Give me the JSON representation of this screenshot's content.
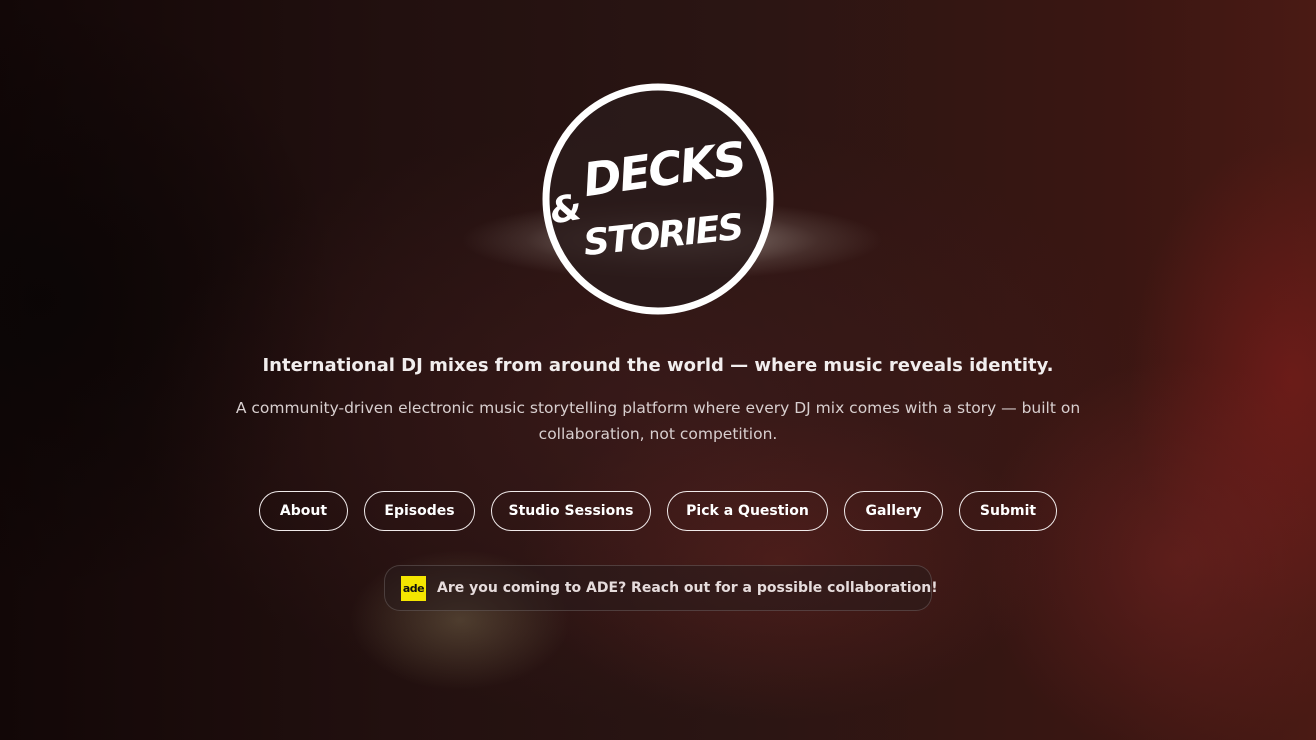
{
  "logo": {
    "line1": "DECKS",
    "ampersand": "&",
    "line2": "STORIES"
  },
  "hero": {
    "tagline": "International DJ mixes from around the world — where music reveals identity.",
    "description": "A community-driven electronic music storytelling platform where every DJ mix comes with a story — built on collaboration, not competition."
  },
  "nav": {
    "items": [
      {
        "label": "About"
      },
      {
        "label": "Episodes"
      },
      {
        "label": "Studio Sessions"
      },
      {
        "label": "Pick a Question"
      },
      {
        "label": "Gallery"
      },
      {
        "label": "Submit"
      }
    ]
  },
  "notice": {
    "logo_text": "ade",
    "text": "Are you coming to ADE? Reach out for a possible collaboration!"
  },
  "colors": {
    "ade_yellow": "#f5e600",
    "text_primary": "#ffffff",
    "background": "#1a0a0b"
  }
}
